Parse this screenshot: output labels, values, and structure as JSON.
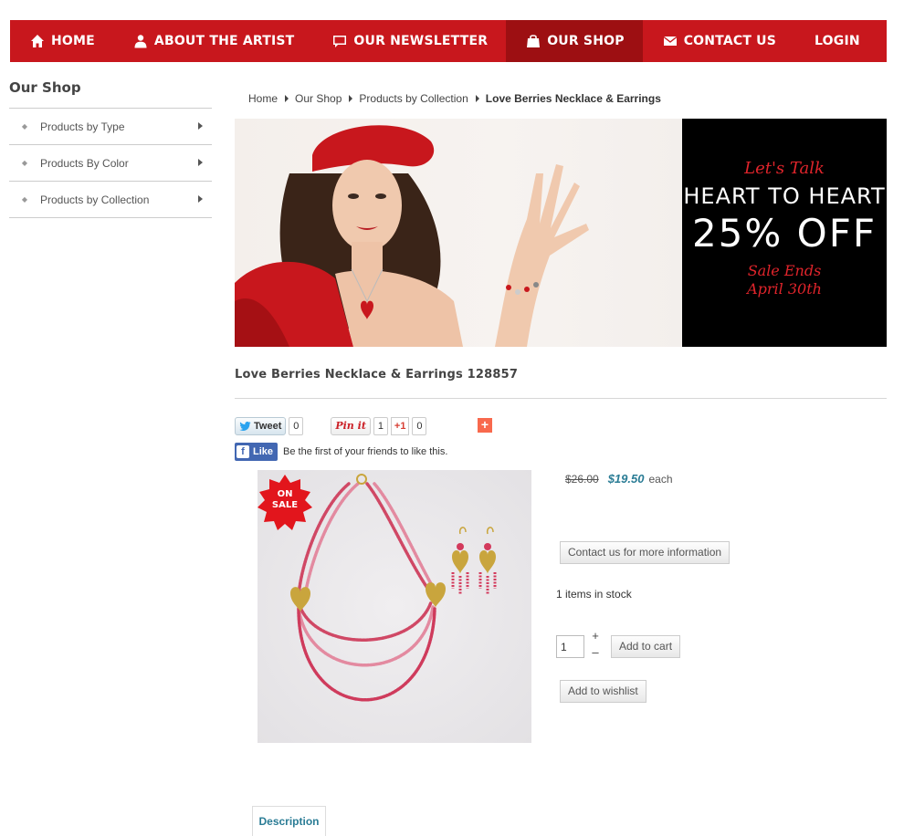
{
  "nav": {
    "items": [
      {
        "label": "HOME",
        "icon": "home-icon"
      },
      {
        "label": "ABOUT THE ARTIST",
        "icon": "user-icon"
      },
      {
        "label": "OUR NEWSLETTER",
        "icon": "chat-icon"
      },
      {
        "label": "OUR SHOP",
        "icon": "shopping-bag-icon",
        "active": true
      },
      {
        "label": "CONTACT US",
        "icon": "envelope-icon"
      },
      {
        "label": "LOGIN"
      }
    ],
    "colors": {
      "bar": "#c8171d",
      "active": "#9d0f12"
    }
  },
  "sidebar": {
    "title": "Our Shop",
    "items": [
      {
        "label": "Products by Type"
      },
      {
        "label": "Products By Color"
      },
      {
        "label": "Products by Collection"
      }
    ]
  },
  "breadcrumb": {
    "items": [
      "Home",
      "Our Shop",
      "Products by Collection"
    ],
    "current": "Love Berries Necklace & Earrings"
  },
  "banner": {
    "line1": "Let's Talk",
    "line2": "HEART TO HEART",
    "line3": "25% OFF",
    "line4": "Sale Ends",
    "line5": "April 30th"
  },
  "product": {
    "title": "Love Berries Necklace & Earrings 128857",
    "badge_line1": "ON",
    "badge_line2": "SALE",
    "old_price": "$26.00",
    "sale_price": "$19.50",
    "each_label": "each",
    "contact_button": "Contact us for more information",
    "stock_text": "1 items in stock",
    "quantity": "1",
    "plus_label": "+",
    "minus_label": "–",
    "add_to_cart": "Add to cart",
    "add_to_wishlist": "Add to wishlist"
  },
  "social": {
    "tweet_label": "Tweet",
    "tweet_count": "0",
    "pin_label": "Pin it",
    "pin_count": "1",
    "gplus_label": "+1",
    "gplus_count": "0",
    "fb_like_label": "Like",
    "fb_text": "Be the first of your friends to like this."
  },
  "tabs": {
    "description": "Description"
  },
  "colors": {
    "accent_red": "#c8171d",
    "link_teal": "#2a7c95"
  }
}
